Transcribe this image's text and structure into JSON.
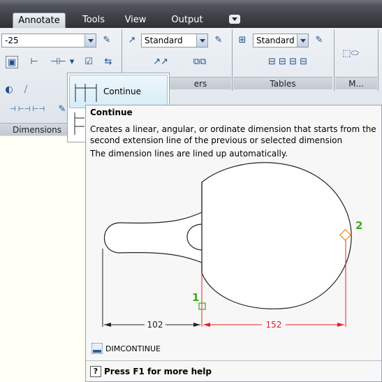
{
  "tabs": [
    {
      "label": "Annotate",
      "active": true
    },
    {
      "label": "Tools",
      "active": false
    },
    {
      "label": "View",
      "active": false
    },
    {
      "label": "Output",
      "active": false
    }
  ],
  "ribbon": {
    "dim_style_value": "-25",
    "multileader_style_value": "Standard",
    "table_style_value": "Standard",
    "panels": {
      "dimensions": "Dimensions",
      "leaders_partial": "ers",
      "tables": "Tables",
      "markup_partial": "M..."
    }
  },
  "dropdown": {
    "item_label": "Continue"
  },
  "tooltip": {
    "title": "Continue",
    "description": "Creates a linear, angular, or ordinate dimension that starts from the second extension line of the previous or selected dimension",
    "note": "The dimension lines are lined up automatically.",
    "command": "DIMCONTINUE",
    "help": "Press F1 for more help",
    "illustration": {
      "point1_label": "1",
      "point2_label": "2",
      "dim_left_value": "102",
      "dim_right_value": "152"
    }
  },
  "colors": {
    "tab_bg": "#3d4047",
    "ribbon_bg": "#e6ebf0",
    "highlight": "#d5ecf7",
    "dim_red": "#e8202a",
    "point_green": "#3aaa1d",
    "point2_orange": "#f08a18"
  }
}
